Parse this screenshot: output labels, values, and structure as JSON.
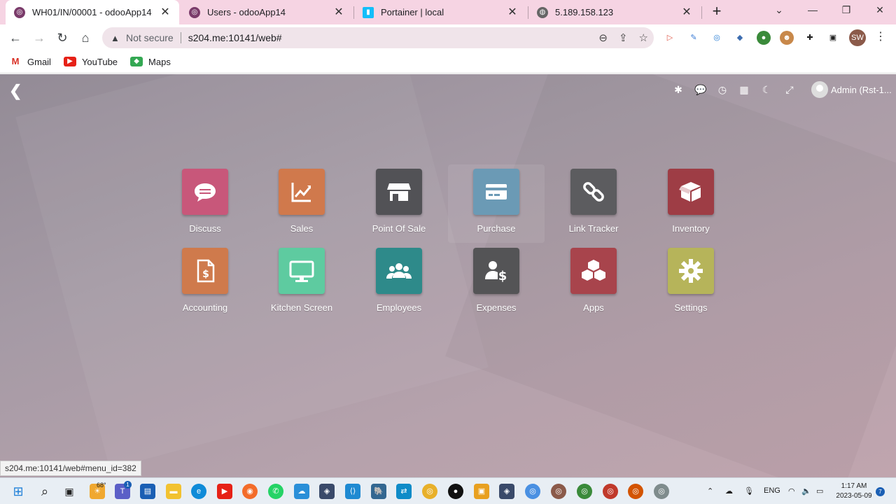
{
  "browser": {
    "tabs": [
      {
        "title": "WH01/IN/00001 - odooApp14",
        "active": true,
        "icon": "odoo-icon"
      },
      {
        "title": "Users - odooApp14",
        "active": false,
        "icon": "odoo-icon"
      },
      {
        "title": "Portainer | local",
        "active": false,
        "icon": "portainer-icon"
      },
      {
        "title": "5.189.158.123",
        "active": false,
        "icon": "globe-icon"
      }
    ],
    "security_label": "Not secure",
    "url": "s204.me:10141/web#",
    "profile_initials": "SW",
    "bookmarks": [
      {
        "label": "Gmail",
        "icon": "gmail-icon"
      },
      {
        "label": "YouTube",
        "icon": "youtube-icon"
      },
      {
        "label": "Maps",
        "icon": "maps-icon"
      }
    ]
  },
  "odoo": {
    "user_label": "Admin (Rst-1...",
    "apps": [
      {
        "label": "Discuss",
        "color": "#c8577a",
        "icon": "discuss-icon"
      },
      {
        "label": "Sales",
        "color": "#d0794c",
        "icon": "sales-icon"
      },
      {
        "label": "Point Of Sale",
        "color": "#525256",
        "icon": "pos-icon"
      },
      {
        "label": "Purchase",
        "color": "#6b9ab5",
        "icon": "purchase-icon"
      },
      {
        "label": "Link Tracker",
        "color": "#5c5c5f",
        "icon": "link-icon"
      },
      {
        "label": "Inventory",
        "color": "#9e3d45",
        "icon": "inventory-icon"
      },
      {
        "label": "Accounting",
        "color": "#cf7a4c",
        "icon": "accounting-icon"
      },
      {
        "label": "Kitchen Screen",
        "color": "#5ecba0",
        "icon": "kitchen-screen-icon"
      },
      {
        "label": "Employees",
        "color": "#2e8a8a",
        "icon": "employees-icon"
      },
      {
        "label": "Expenses",
        "color": "#545456",
        "icon": "expenses-icon"
      },
      {
        "label": "Apps",
        "color": "#a8444c",
        "icon": "apps-icon"
      },
      {
        "label": "Settings",
        "color": "#b6b45a",
        "icon": "settings-icon"
      }
    ]
  },
  "status_url": "s204.me:10141/web#menu_id=382",
  "taskbar": {
    "weather": "68°",
    "language": "ENG",
    "time": "1:17 AM",
    "date": "2023-05-09",
    "notification_count": "7",
    "teams_badge": "1"
  }
}
